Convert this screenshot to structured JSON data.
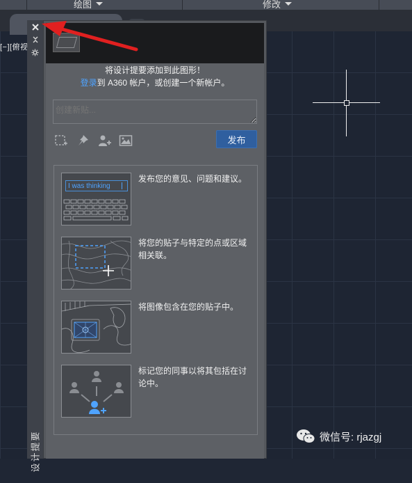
{
  "ribbon": {
    "panel_draw": "绘图",
    "panel_modify": "修改"
  },
  "viewport": {
    "label": "[−][俯视"
  },
  "palette": {
    "title": "设计提要",
    "close_icon": "close-icon",
    "autohide_icon": "autohide-icon",
    "properties_icon": "gear-icon"
  },
  "banner": {
    "message_line1": "将设计提要添加到此图形！",
    "login_link": "登录",
    "message_line2_rest": "到 A360 帐户，或创建一个新帐户。"
  },
  "composer": {
    "placeholder": "创建新贴...",
    "tools": [
      "select-area-icon",
      "pin-icon",
      "add-person-icon",
      "image-icon"
    ],
    "publish_label": "发布"
  },
  "tips": [
    {
      "text": "发布您的意见、问题和建议。",
      "sample_text": "I was thinking"
    },
    {
      "text": "将您的贴子与特定的点或区域相关联。"
    },
    {
      "text": "将图像包含在您的贴子中。"
    },
    {
      "text": "标记您的同事以将其包括在讨论中。"
    }
  ],
  "watermark": {
    "text": "微信号: rjazgj"
  },
  "colors": {
    "link": "#4fa3ff",
    "publish_button": "#2f5f9f",
    "annotation_arrow": "#e02020"
  }
}
